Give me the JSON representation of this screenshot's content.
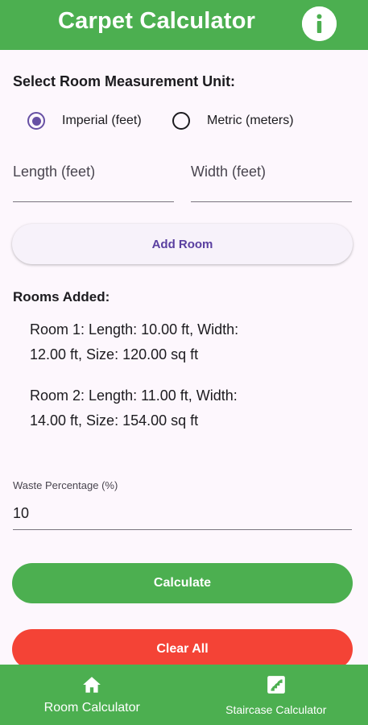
{
  "app_bar": {
    "title": "Carpet Calculator",
    "info_icon": "info-icon",
    "background": "#4caf50"
  },
  "unit_selection": {
    "label": "Select Room Measurement Unit:",
    "options": [
      {
        "label": "Imperial (feet)",
        "selected": true
      },
      {
        "label": "Metric (meters)",
        "selected": false
      }
    ],
    "accent": "#6750a4"
  },
  "inputs": {
    "length_placeholder": "Length (feet)",
    "width_placeholder": "Width (feet)"
  },
  "add_room_label": "Add Room",
  "rooms": {
    "title": "Rooms Added:",
    "items": [
      {
        "line1": "Room 1: Length: 10.00 ft, Width:",
        "line2": "12.00 ft, Size: 120.00 sq ft"
      },
      {
        "line1": "Room 2: Length: 11.00 ft, Width:",
        "line2": "14.00 ft, Size: 154.00 sq ft"
      }
    ]
  },
  "waste": {
    "label": "Waste Percentage (%)",
    "value": "10"
  },
  "buttons": {
    "calculate": "Calculate",
    "clear": "Clear All",
    "calculate_color": "#4caf50",
    "clear_color": "#f44336"
  },
  "bottom_nav": {
    "items": [
      {
        "label": "Room Calculator",
        "icon": "home-icon"
      },
      {
        "label": "Staircase Calculator",
        "icon": "stairs-icon"
      }
    ]
  }
}
